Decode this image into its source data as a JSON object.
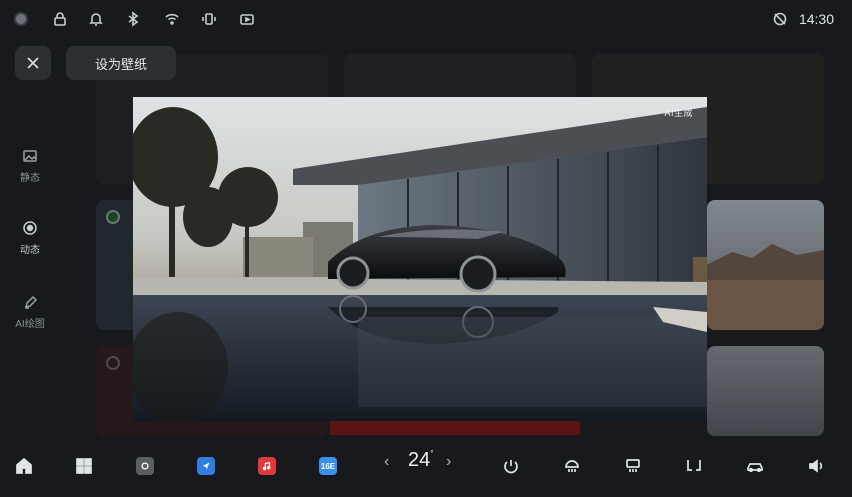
{
  "status_bar": {
    "time": "14:30",
    "icons": [
      "avatar-icon",
      "lock-icon",
      "bell-icon",
      "bluetooth-icon",
      "wifi-icon",
      "vibrate-icon",
      "camera-icon",
      "no-disturb-icon"
    ]
  },
  "sidebar": {
    "items": [
      {
        "label": "静态",
        "icon": "image-icon",
        "active": false
      },
      {
        "label": "动态",
        "icon": "record-icon",
        "active": true
      },
      {
        "label": "AI绘图",
        "icon": "ai-draw-icon",
        "active": false
      }
    ]
  },
  "toolbar": {
    "set_wallpaper_label": "设为壁纸"
  },
  "preview": {
    "badge": "AI生成"
  },
  "dock": {
    "temperature": "24",
    "temp_unit": "°",
    "temp_prev": "‹",
    "temp_next": "›",
    "apps": [
      {
        "name": "home",
        "icon": "home-icon"
      },
      {
        "name": "apps",
        "icon": "grid-icon"
      },
      {
        "name": "camera-app",
        "icon": "camera-app-icon",
        "color": "#5a5e64"
      },
      {
        "name": "nav-app",
        "icon": "navigation-app-icon",
        "color": "#2f7fe0"
      },
      {
        "name": "music-app",
        "icon": "music-app-icon",
        "color": "#e23a3a"
      },
      {
        "name": "calendar-app",
        "icon": "calendar-app-icon",
        "color": "#3a8fe8",
        "text": "16E"
      }
    ],
    "controls": [
      "seat-heat-icon",
      "front-defrost-icon",
      "rear-defrost-icon",
      "seat-icon",
      "car-air-icon",
      "volume-icon"
    ]
  }
}
